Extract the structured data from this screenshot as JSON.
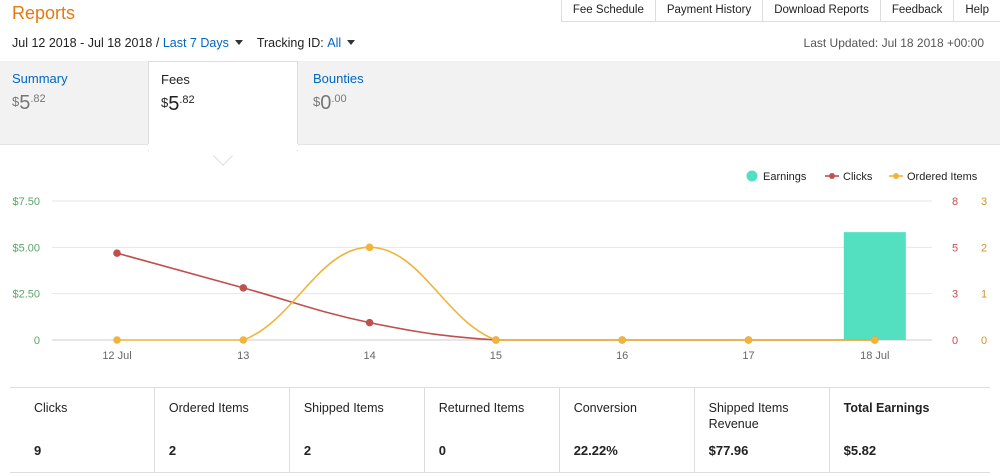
{
  "header": {
    "title": "Reports",
    "nav": [
      "Fee Schedule",
      "Payment History",
      "Download Reports",
      "Feedback",
      "Help"
    ]
  },
  "filters": {
    "date_range": "Jul 12 2018 - Jul 18 2018 /",
    "period": "Last 7 Days",
    "tracking_label": "Tracking ID:",
    "tracking_value": "All",
    "last_updated": "Last Updated: Jul 18 2018 +00:00"
  },
  "tabs": [
    {
      "label": "Summary",
      "currency": "$",
      "whole": "5",
      "fraction": ".82",
      "active": false
    },
    {
      "label": "Fees",
      "currency": "$",
      "whole": "5",
      "fraction": ".82",
      "active": true
    },
    {
      "label": "Bounties",
      "currency": "$",
      "whole": "0",
      "fraction": ".00",
      "active": false
    }
  ],
  "metrics": [
    {
      "label": "Clicks",
      "value": "9"
    },
    {
      "label": "Ordered Items",
      "value": "2"
    },
    {
      "label": "Shipped Items",
      "value": "2"
    },
    {
      "label": "Returned Items",
      "value": "0"
    },
    {
      "label": "Conversion",
      "value": "22.22%"
    },
    {
      "label": "Shipped Items Revenue",
      "value": "$77.96"
    },
    {
      "label": "Total Earnings",
      "value": "$5.82"
    }
  ],
  "chart_data": {
    "type": "bar+line",
    "categories": [
      "12 Jul",
      "13",
      "14",
      "15",
      "16",
      "17",
      "18 Jul"
    ],
    "legend": [
      "Earnings",
      "Clicks",
      "Ordered Items"
    ],
    "legend_position": "top-right",
    "grid": true,
    "y_left": {
      "ticks": [
        "0",
        "$2.50",
        "$5.00",
        "$7.50"
      ],
      "range": [
        0,
        7.5
      ]
    },
    "y_clicks": {
      "ticks": [
        "0",
        "3",
        "5",
        "8"
      ],
      "range": [
        0,
        8
      ]
    },
    "y_items": {
      "ticks": [
        "0",
        "1",
        "2",
        "3"
      ],
      "range": [
        0,
        3
      ]
    },
    "series": [
      {
        "name": "Earnings",
        "kind": "bar",
        "axis": "left",
        "color": "#53e0c0",
        "values": [
          0,
          0,
          0,
          0,
          0,
          0,
          5.82
        ]
      },
      {
        "name": "Clicks",
        "kind": "line",
        "axis": "clicks",
        "color": "#c0504d",
        "values": [
          5,
          3,
          1,
          0,
          0,
          0,
          0
        ]
      },
      {
        "name": "Ordered Items",
        "kind": "line",
        "axis": "items",
        "color": "#f0b43c",
        "values": [
          0,
          0,
          2,
          0,
          0,
          0,
          0
        ]
      }
    ]
  }
}
